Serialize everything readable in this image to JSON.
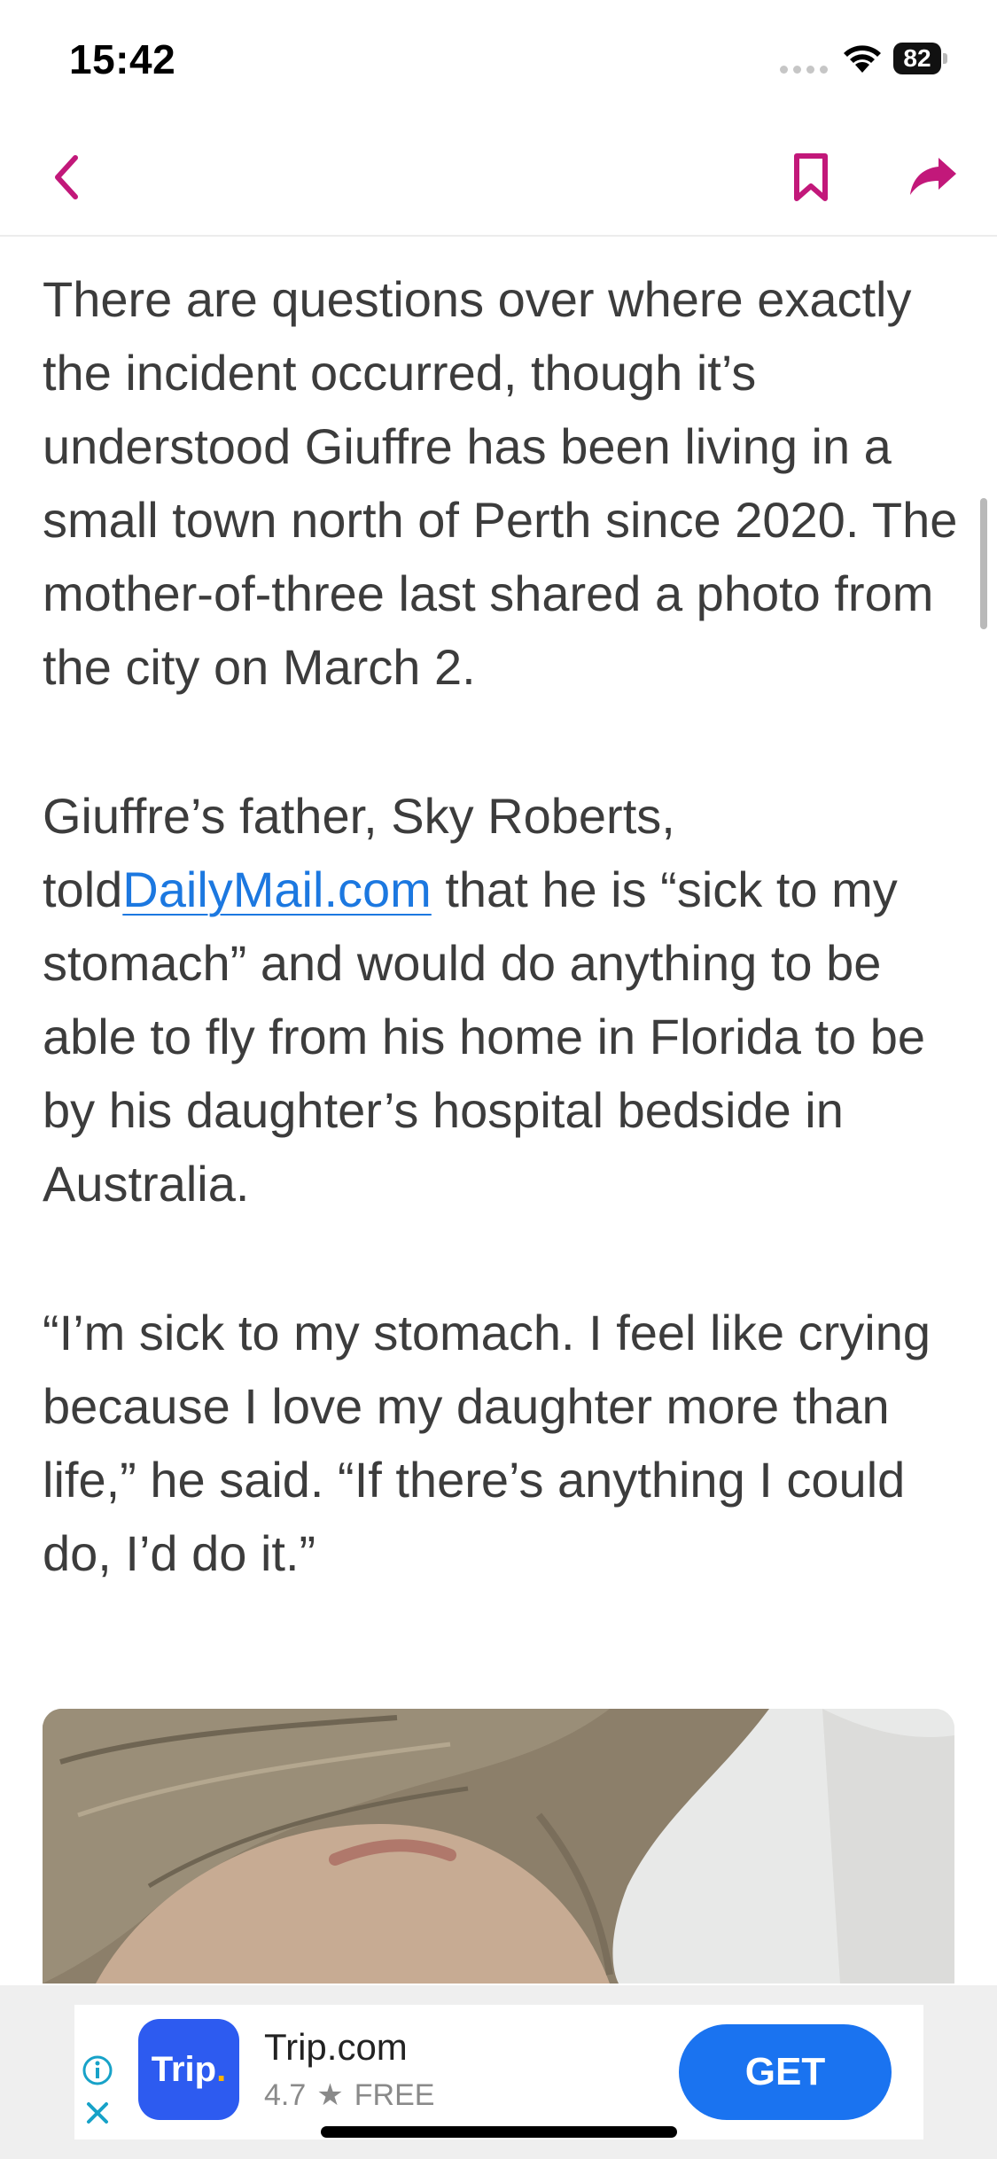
{
  "status_bar": {
    "time": "15:42",
    "battery_level": "82"
  },
  "article": {
    "paragraph_1": "There are questions over where exactly the incident occurred, though it’s understood Giuffre has been living in a small town north of Perth since 2020. The mother-of-three last shared a photo from the city on March 2.",
    "paragraph_2_before": "Giuffre’s father, Sky Roberts, told",
    "paragraph_2_link": "DailyMail.com",
    "paragraph_2_after": " that he is “sick to my stomach” and would do anything to be able to fly from his home in Florida to be by his daughter’s hospital bedside in Australia.",
    "paragraph_3": "“I’m sick to my stomach. I feel like crying because I love my daughter more than life,” he said. “If there’s anything I could do, I’d do it.”"
  },
  "ad": {
    "icon_text": "Trip",
    "icon_dot": ".",
    "app_name": "Trip.com",
    "rating": "4.7",
    "price": "FREE",
    "cta": "GET"
  },
  "colors": {
    "accent": "#c2187a",
    "link": "#1c78e0",
    "ad_button": "#1a73f0",
    "ad_icon": "#2d5bf0"
  }
}
